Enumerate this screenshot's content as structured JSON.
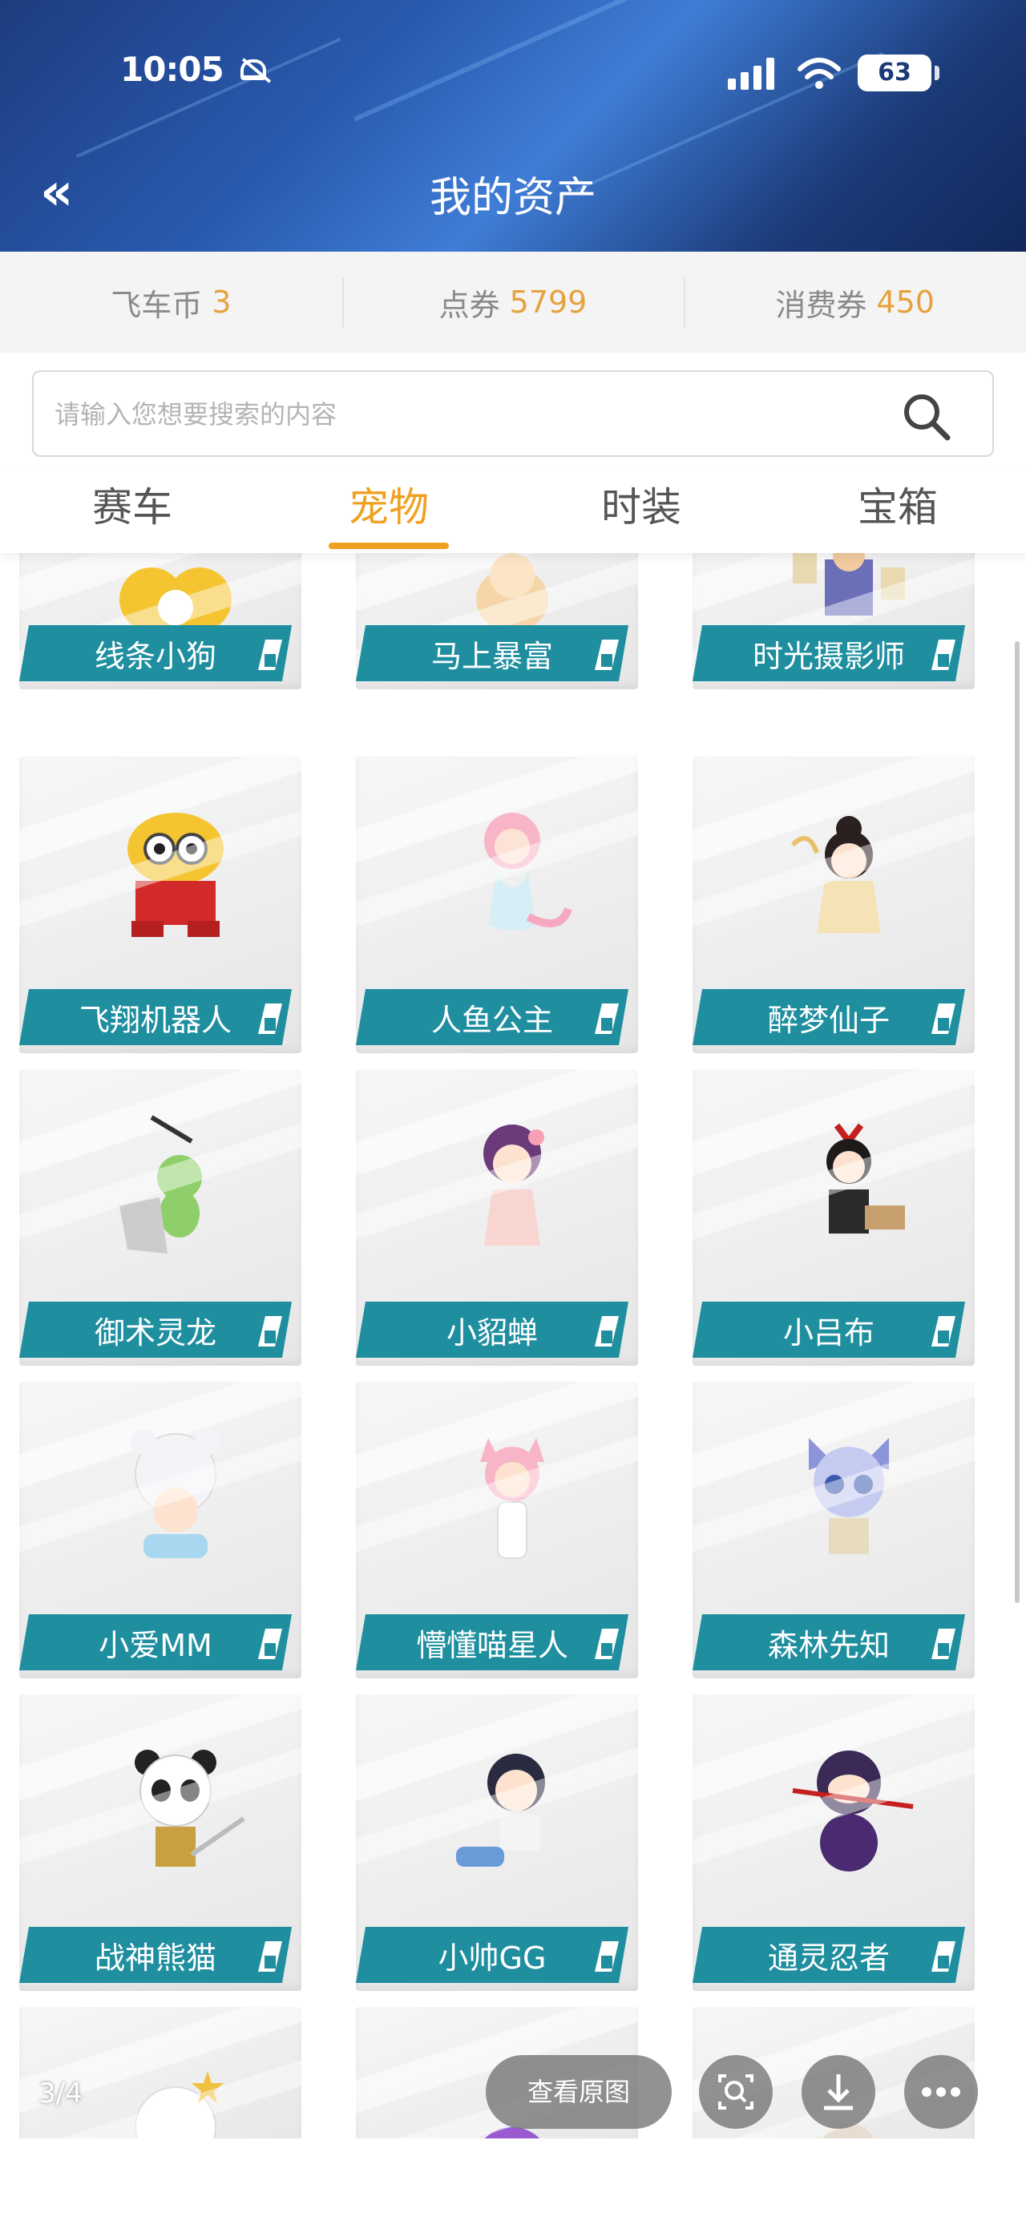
{
  "status_bar": {
    "time": "10:05",
    "battery": "63"
  },
  "header": {
    "title": "我的资产",
    "back_icon": "double-chevron-left-icon"
  },
  "currencies": [
    {
      "label": "飞车币",
      "amount": "3"
    },
    {
      "label": "点券",
      "amount": "5799"
    },
    {
      "label": "消费券",
      "amount": "450"
    }
  ],
  "search": {
    "placeholder": "请输入您想要搜索的内容",
    "value": ""
  },
  "tabs": [
    {
      "label": "赛车",
      "active": false
    },
    {
      "label": "宠物",
      "active": true
    },
    {
      "label": "时装",
      "active": false
    },
    {
      "label": "宝箱",
      "active": false
    }
  ],
  "pets": [
    {
      "name": "线条小狗"
    },
    {
      "name": "马上暴富"
    },
    {
      "name": "时光摄影师"
    },
    {
      "name": "飞翔机器人"
    },
    {
      "name": "人鱼公主"
    },
    {
      "name": "醉梦仙子"
    },
    {
      "name": "御术灵龙"
    },
    {
      "name": "小貂蝉"
    },
    {
      "name": "小吕布"
    },
    {
      "name": "小爱MM"
    },
    {
      "name": "懵懂喵星人"
    },
    {
      "name": "森林先知"
    },
    {
      "name": "战神熊猫"
    },
    {
      "name": "小帅GG"
    },
    {
      "name": "通灵忍者"
    }
  ],
  "viewer": {
    "page_counter": "3/4",
    "view_original": "查看原图"
  },
  "colors": {
    "accent": "#f0a020",
    "label_bg": "#1f8fa0",
    "amount": "#e6a23c"
  }
}
